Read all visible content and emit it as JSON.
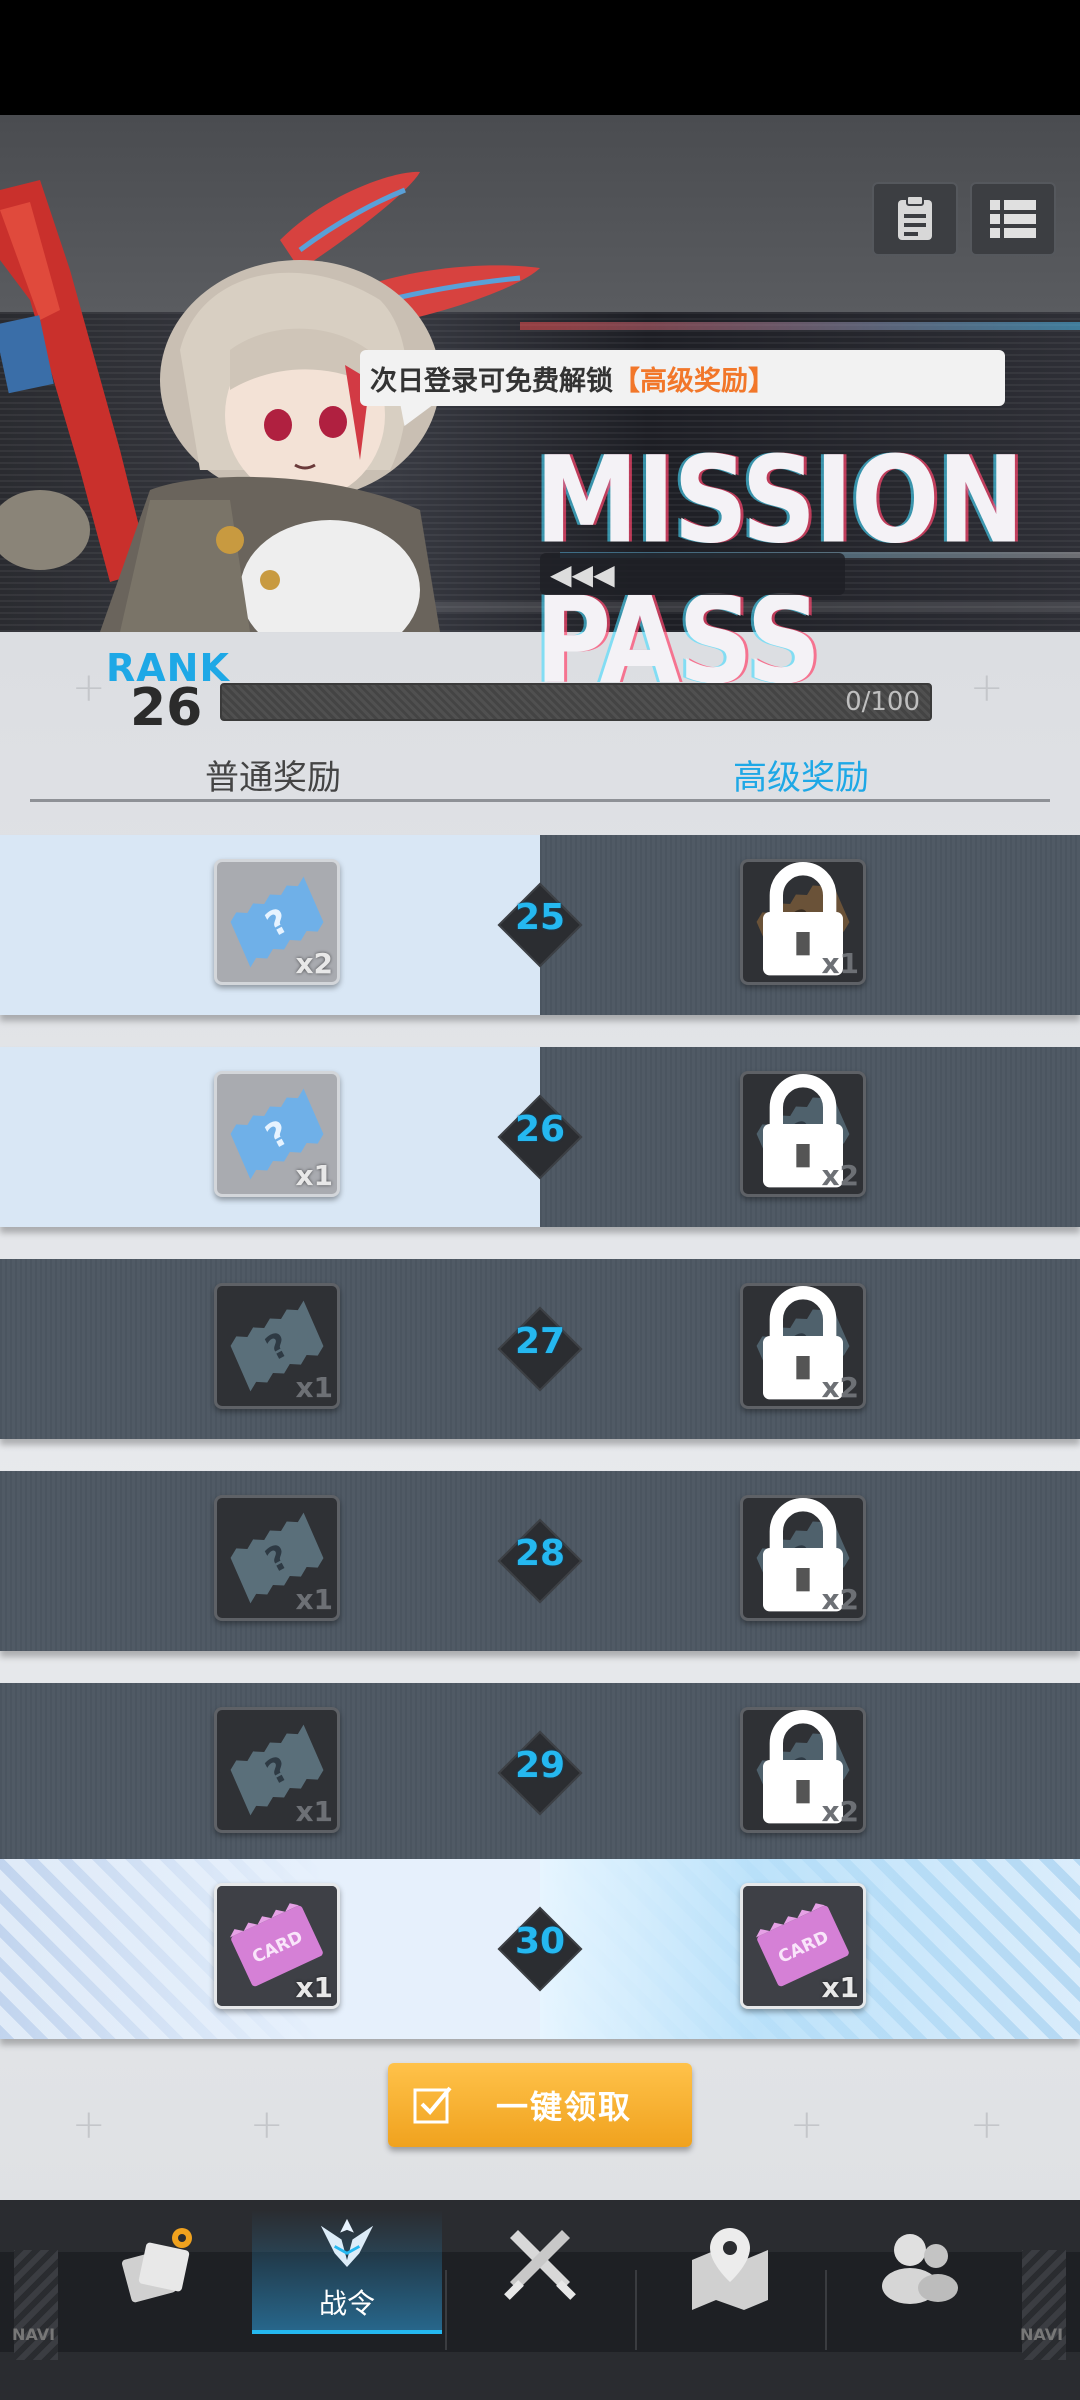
{
  "banner": {
    "notice_prefix": "次日登录可免费解锁",
    "notice_highlight": "【高级奖励】",
    "title": "MISSION PASS"
  },
  "rank": {
    "label": "RANK",
    "value": "26",
    "progress_text": "0/100",
    "progress_fraction": 0
  },
  "columns": {
    "normal": "普通奖励",
    "premium": "高级奖励"
  },
  "rewards": [
    {
      "level": "25",
      "normal_qty": "x2",
      "premium_qty": "x1",
      "normal_claimable": true
    },
    {
      "level": "26",
      "normal_qty": "x1",
      "premium_qty": "x2",
      "normal_claimable": true
    },
    {
      "level": "27",
      "normal_qty": "x1",
      "premium_qty": "x2",
      "normal_claimable": false
    },
    {
      "level": "28",
      "normal_qty": "x1",
      "premium_qty": "x2",
      "normal_claimable": false
    },
    {
      "level": "29",
      "normal_qty": "x1",
      "premium_qty": "x2",
      "normal_claimable": false
    },
    {
      "level": "30",
      "normal_qty": "x1",
      "premium_qty": "x1",
      "normal_claimable": false,
      "final": true
    }
  ],
  "final_item_text": "CARD",
  "claim_all": "一键领取",
  "nav": {
    "active_label": "战令",
    "navi_left": "NAVI",
    "navi_right": "NAVI"
  },
  "colors": {
    "accent": "#1ea8e6",
    "highlight": "#f2772a",
    "claim": "#f0a21e"
  }
}
